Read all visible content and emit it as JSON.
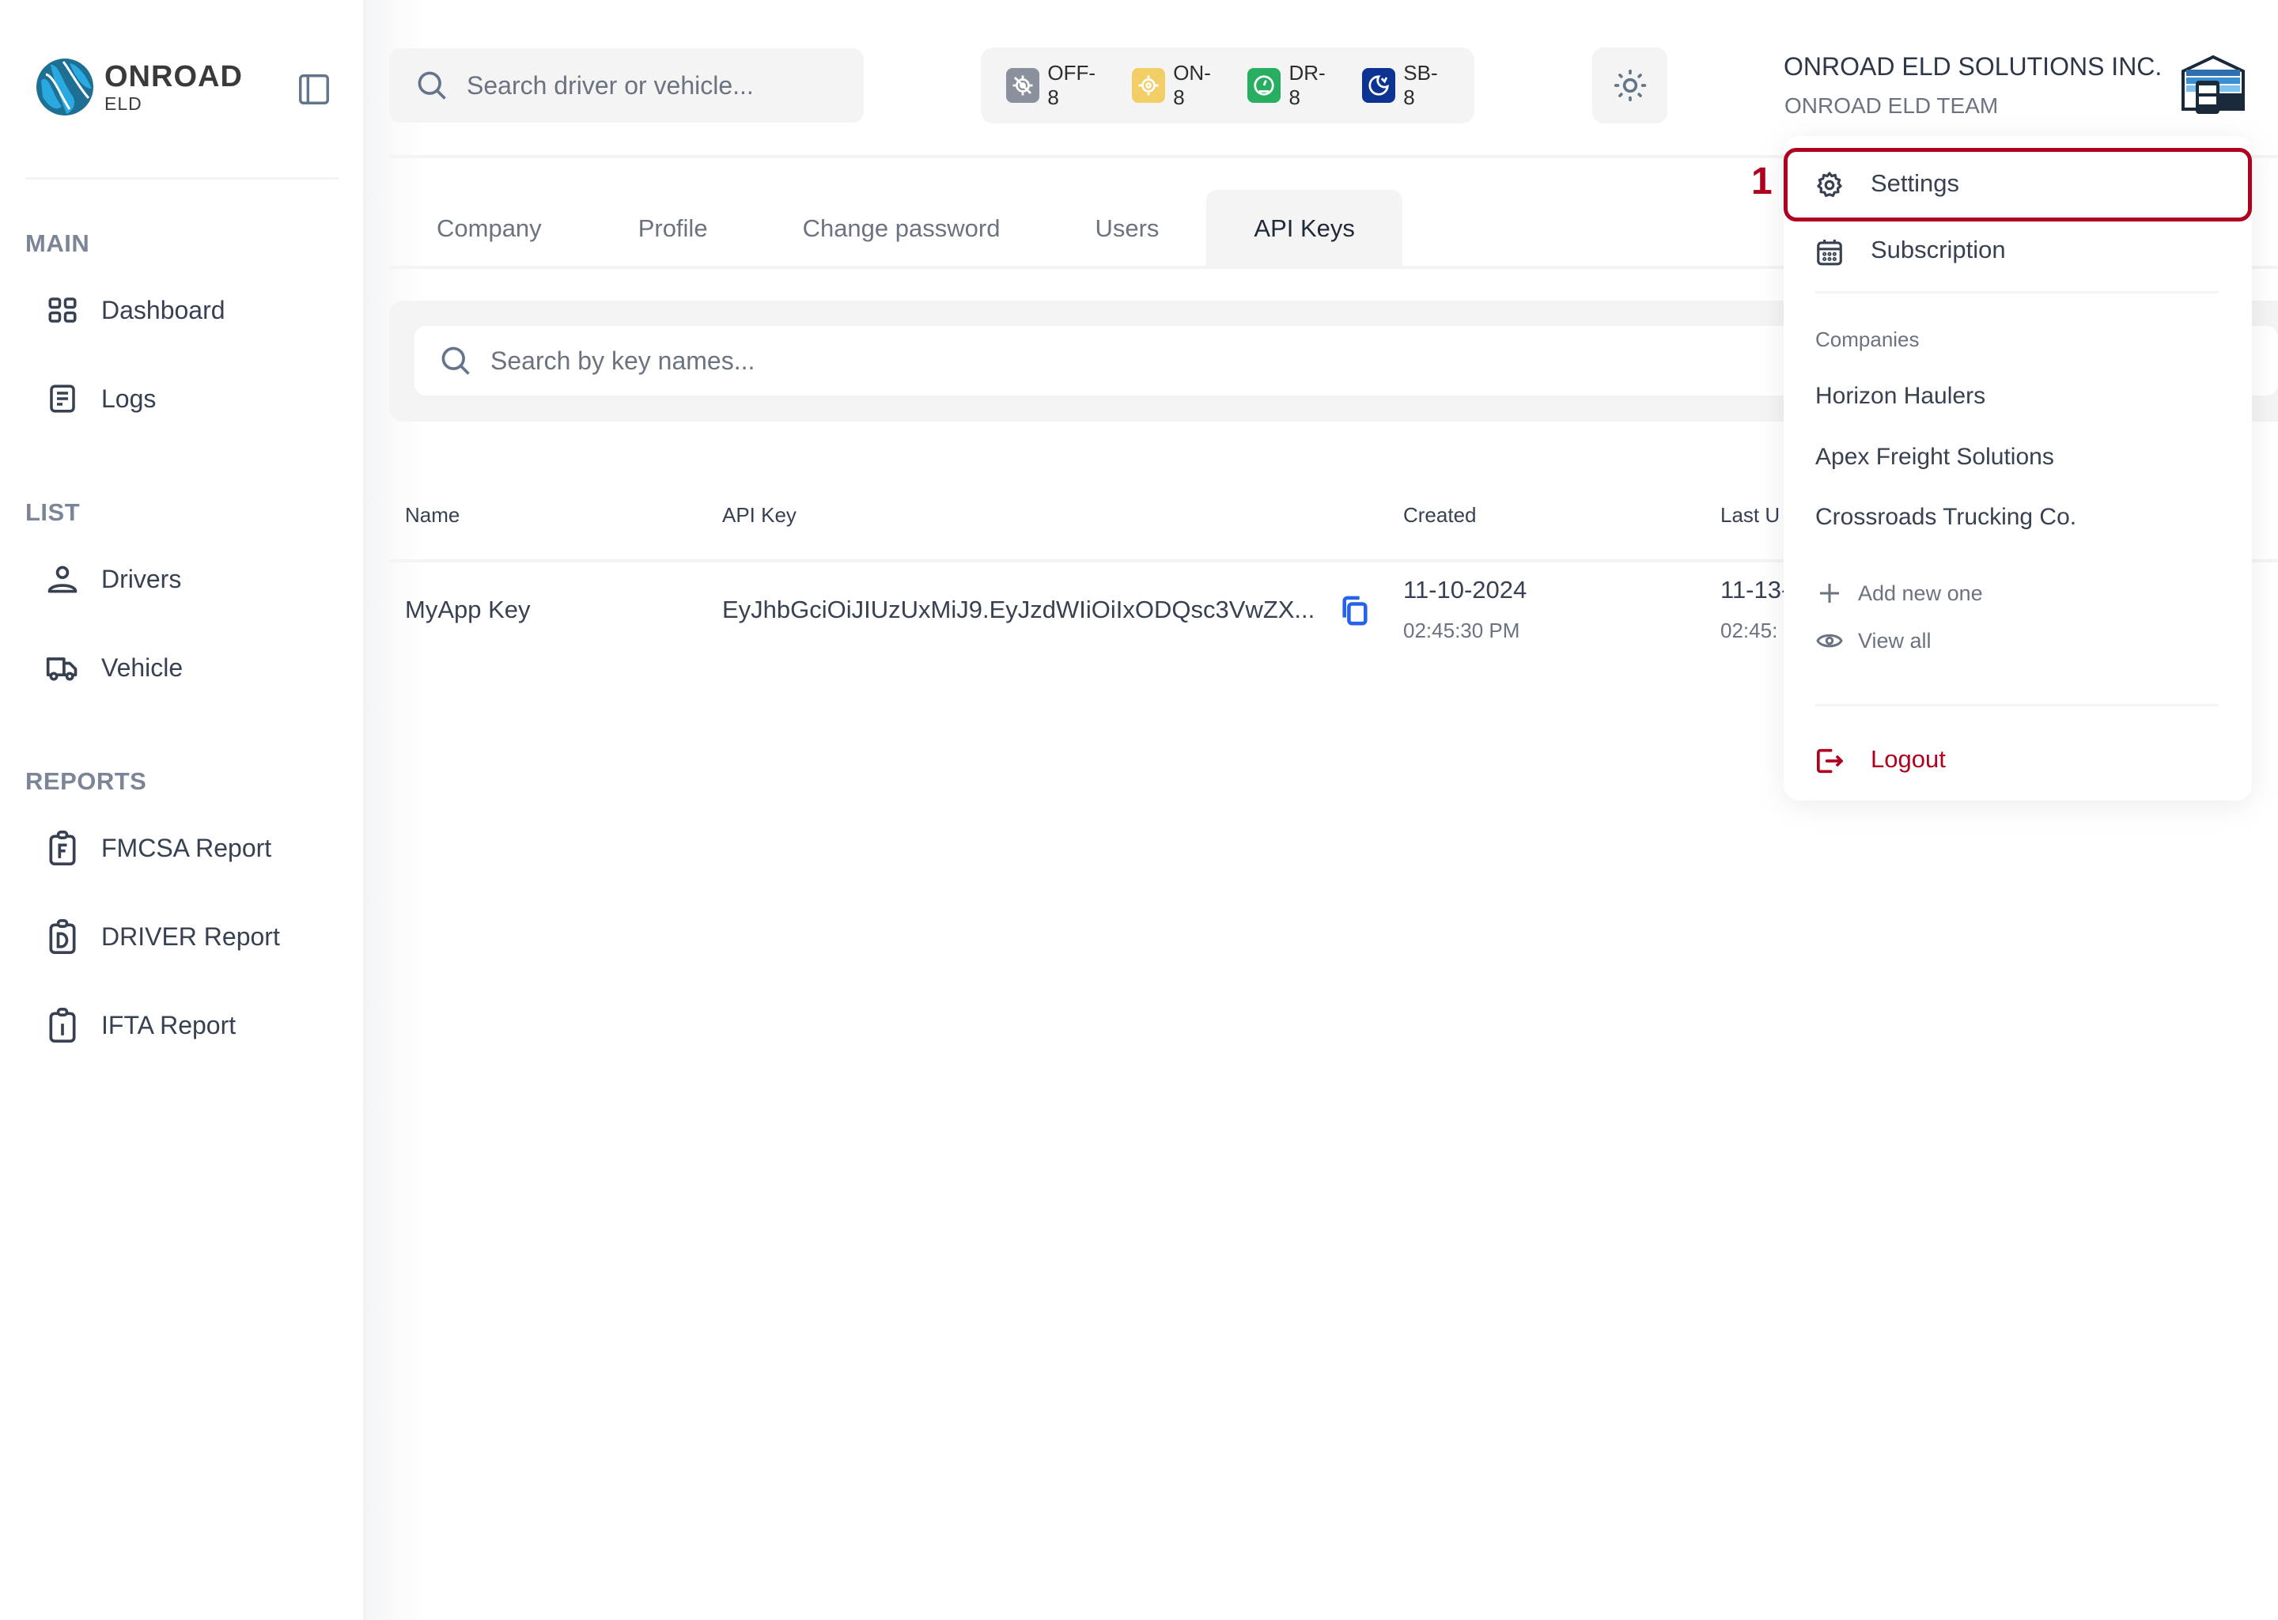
{
  "brand": {
    "title": "ONROAD",
    "subtitle": "ELD"
  },
  "sidebar": {
    "sections": [
      {
        "label": "MAIN",
        "items": [
          {
            "label": "Dashboard",
            "icon": "grid-icon"
          },
          {
            "label": "Logs",
            "icon": "document-icon"
          }
        ]
      },
      {
        "label": "LIST",
        "items": [
          {
            "label": "Drivers",
            "icon": "user-icon"
          },
          {
            "label": "Vehicle",
            "icon": "truck-icon"
          }
        ]
      },
      {
        "label": "REPORTS",
        "items": [
          {
            "label": "FMCSA Report",
            "icon": "clipboard-f-icon"
          },
          {
            "label": "DRIVER Report",
            "icon": "clipboard-d-icon"
          },
          {
            "label": "IFTA Report",
            "icon": "clipboard-i-icon"
          }
        ]
      }
    ]
  },
  "header": {
    "search_placeholder": "Search driver or vehicle...",
    "statuses": [
      {
        "label": "OFF-8",
        "color": "#8a909c",
        "icon": "off-duty-icon"
      },
      {
        "label": "ON-8",
        "color": "#f3cd66",
        "icon": "on-duty-icon"
      },
      {
        "label": "DR-8",
        "color": "#27ae60",
        "icon": "driving-icon"
      },
      {
        "label": "SB-8",
        "color": "#0d3392",
        "icon": "sleeper-icon"
      }
    ],
    "company_name": "ONROAD ELD SOLUTIONS INC.",
    "team_name": "ONROAD ELD TEAM"
  },
  "tabs": [
    {
      "label": "Company",
      "active": false
    },
    {
      "label": "Profile",
      "active": false
    },
    {
      "label": "Change password",
      "active": false
    },
    {
      "label": "Users",
      "active": false
    },
    {
      "label": "API Keys",
      "active": true
    }
  ],
  "api_keys": {
    "search_placeholder": "Search by key names...",
    "columns": [
      "Name",
      "API Key",
      "Created",
      "Last U"
    ],
    "rows": [
      {
        "name": "MyApp Key",
        "key": "EyJhbGciOiJIUzUxMiJ9.EyJzdWIiOiIxODQsc3VwZX...",
        "created_date": "11-10-2024",
        "created_time": "02:45:30 PM",
        "last_used_date": "11-13-",
        "last_used_time": "02:45:"
      }
    ]
  },
  "dropdown": {
    "settings_label": "Settings",
    "subscription_label": "Subscription",
    "companies_heading": "Companies",
    "companies": [
      "Horizon Haulers",
      "Apex Freight Solutions",
      "Crossroads Trucking Co."
    ],
    "add_new_label": "Add new one",
    "view_all_label": "View all",
    "logout_label": "Logout"
  },
  "annotation": {
    "step": "1",
    "color": "#b0001f"
  }
}
